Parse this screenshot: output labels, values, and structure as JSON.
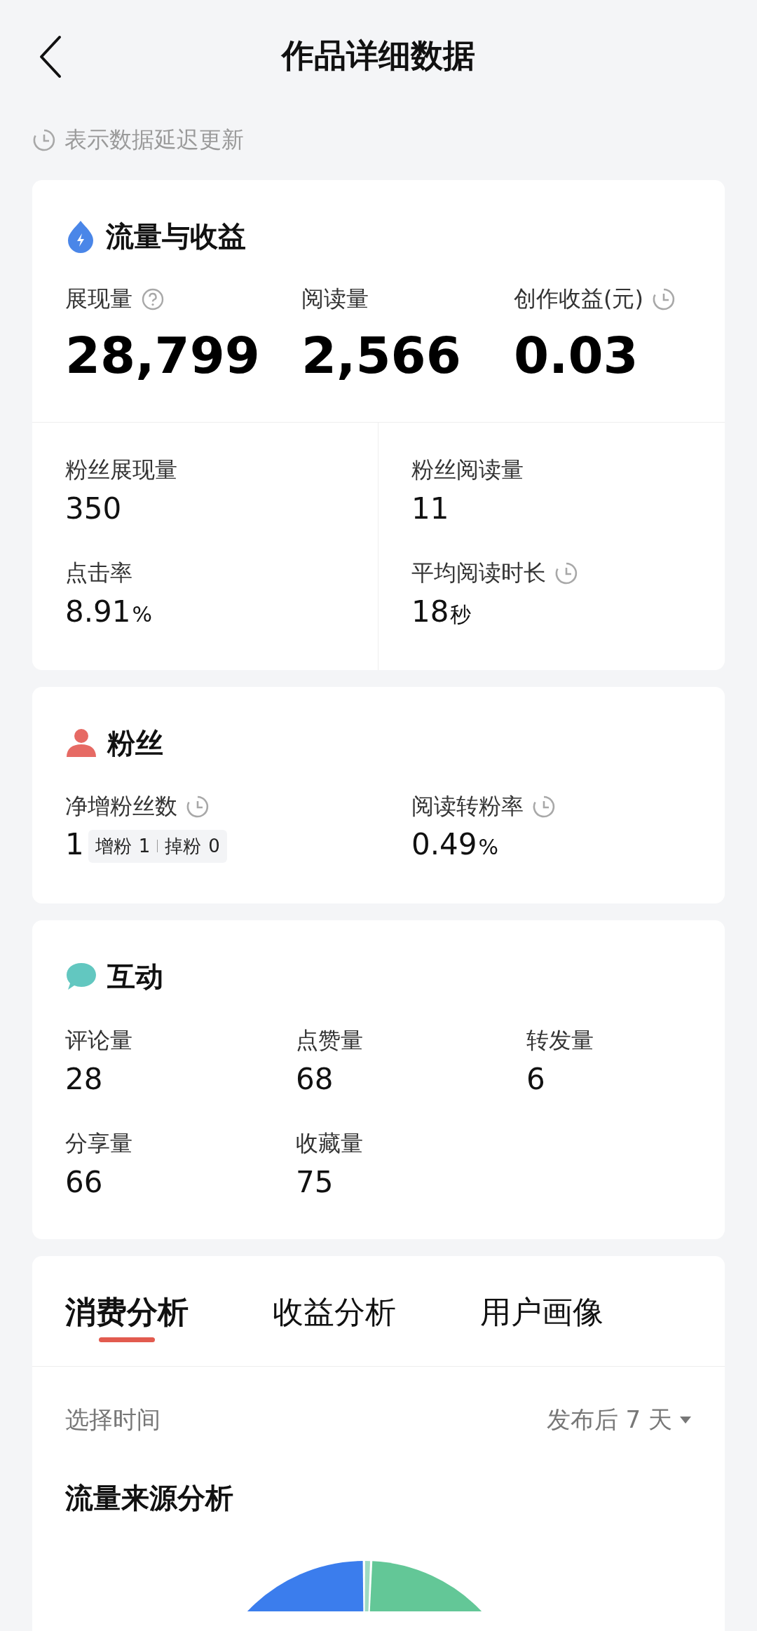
{
  "header": {
    "title": "作品详细数据"
  },
  "notice": "表示数据延迟更新",
  "traffic": {
    "title": "流量与收益",
    "main_metrics": [
      {
        "label": "展现量",
        "help": true,
        "value": "28,799"
      },
      {
        "label": "阅读量",
        "value": "2,566"
      },
      {
        "label": "创作收益(元)",
        "delayed": true,
        "value": "0.03"
      }
    ],
    "sub_metrics": [
      {
        "label": "粉丝展现量",
        "value": "350"
      },
      {
        "label": "粉丝阅读量",
        "value": "11"
      },
      {
        "label": "点击率",
        "value": "8.91",
        "unit": "%"
      },
      {
        "label": "平均阅读时长",
        "delayed": true,
        "value": "18",
        "unit": "秒"
      }
    ]
  },
  "fans": {
    "title": "粉丝",
    "metrics": [
      {
        "label": "净增粉丝数",
        "delayed": true,
        "value": "1",
        "breakdown": [
          {
            "label": "增粉",
            "value": "1"
          },
          {
            "label": "掉粉",
            "value": "0"
          }
        ]
      },
      {
        "label": "阅读转粉率",
        "delayed": true,
        "value": "0.49",
        "unit": "%"
      }
    ]
  },
  "interaction": {
    "title": "互动",
    "metrics": [
      {
        "label": "评论量",
        "value": "28"
      },
      {
        "label": "点赞量",
        "value": "68"
      },
      {
        "label": "转发量",
        "value": "6"
      },
      {
        "label": "分享量",
        "value": "66"
      },
      {
        "label": "收藏量",
        "value": "75"
      }
    ]
  },
  "analysis": {
    "tabs": [
      {
        "label": "消费分析",
        "selected": true
      },
      {
        "label": "收益分析",
        "selected": false
      },
      {
        "label": "用户画像",
        "selected": false
      }
    ],
    "time_filter": {
      "label": "选择时间",
      "value": "发布后 7 天"
    },
    "chart_title": "流量来源分析"
  }
}
